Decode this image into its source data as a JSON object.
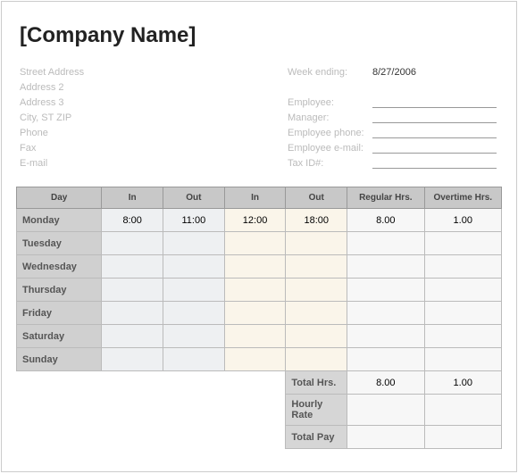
{
  "title": "[Company Name]",
  "left_fields": [
    "Street Address",
    "Address 2",
    "Address 3",
    "City, ST  ZIP",
    "Phone",
    "Fax",
    "E-mail"
  ],
  "right_fields": [
    {
      "label": "Week ending:",
      "value": "8/27/2006",
      "underline": false
    },
    {
      "label": "",
      "value": "",
      "underline": false
    },
    {
      "label": "Employee:",
      "value": "",
      "underline": true
    },
    {
      "label": "Manager:",
      "value": "",
      "underline": true
    },
    {
      "label": "Employee phone:",
      "value": "",
      "underline": true
    },
    {
      "label": "Employee e-mail:",
      "value": "",
      "underline": true
    },
    {
      "label": "Tax ID#:",
      "value": "",
      "underline": true
    }
  ],
  "columns": [
    "Day",
    "In",
    "Out",
    "In",
    "Out",
    "Regular Hrs.",
    "Overtime Hrs."
  ],
  "rows": [
    {
      "day": "Monday",
      "in1": "8:00",
      "out1": "11:00",
      "in2": "12:00",
      "out2": "18:00",
      "reg": "8.00",
      "ot": "1.00"
    },
    {
      "day": "Tuesday",
      "in1": "",
      "out1": "",
      "in2": "",
      "out2": "",
      "reg": "",
      "ot": ""
    },
    {
      "day": "Wednesday",
      "in1": "",
      "out1": "",
      "in2": "",
      "out2": "",
      "reg": "",
      "ot": ""
    },
    {
      "day": "Thursday",
      "in1": "",
      "out1": "",
      "in2": "",
      "out2": "",
      "reg": "",
      "ot": ""
    },
    {
      "day": "Friday",
      "in1": "",
      "out1": "",
      "in2": "",
      "out2": "",
      "reg": "",
      "ot": ""
    },
    {
      "day": "Saturday",
      "in1": "",
      "out1": "",
      "in2": "",
      "out2": "",
      "reg": "",
      "ot": ""
    },
    {
      "day": "Sunday",
      "in1": "",
      "out1": "",
      "in2": "",
      "out2": "",
      "reg": "",
      "ot": ""
    }
  ],
  "summary": {
    "total_hrs_label": "Total Hrs.",
    "total_reg": "8.00",
    "total_ot": "1.00",
    "hourly_rate_label": "Hourly Rate",
    "hourly_reg": "",
    "hourly_ot": "",
    "total_pay_label": "Total Pay",
    "pay_reg": "",
    "pay_ot": ""
  }
}
